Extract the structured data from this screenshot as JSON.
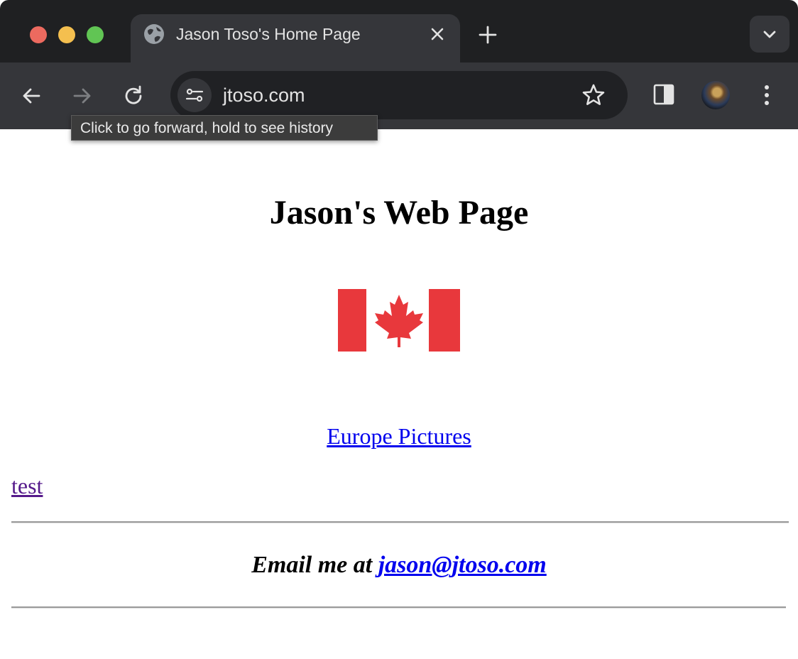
{
  "browser": {
    "tab": {
      "title": "Jason Toso's Home Page"
    },
    "address_bar": {
      "url": "jtoso.com"
    },
    "tooltip": "Click to go forward, hold to see history"
  },
  "page": {
    "heading": "Jason's Web Page",
    "flag_image": "canada-flag",
    "links": {
      "europe": "Europe Pictures",
      "test": "test"
    },
    "email": {
      "prefix": "Email me at ",
      "address": "jason@jtoso.com"
    }
  },
  "colors": {
    "tabbar_bg": "#1f2022",
    "toolbar_bg": "#35363a",
    "link": "#0000ee",
    "visited_link": "#551a8b",
    "flag_red": "#e8383c"
  }
}
